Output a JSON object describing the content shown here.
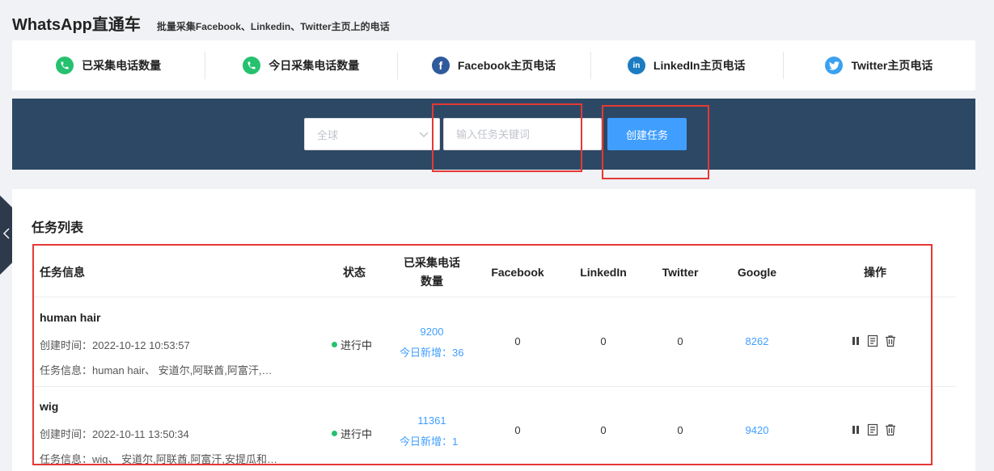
{
  "header": {
    "title": "WhatsApp直通车",
    "subtitle": "批量采集Facebook、Linkedin、Twitter主页上的电话"
  },
  "stats": [
    {
      "label": "已采集电话数量",
      "icon": "phone-icon"
    },
    {
      "label": "今日采集电话数量",
      "icon": "phone-icon"
    },
    {
      "label": "Facebook主页电话",
      "icon": "facebook-icon"
    },
    {
      "label": "LinkedIn主页电话",
      "icon": "linkedin-icon"
    },
    {
      "label": "Twitter主页电话",
      "icon": "twitter-icon"
    }
  ],
  "toolbar": {
    "region_value": "全球",
    "keyword_placeholder": "输入任务关键词",
    "create_label": "创建任务"
  },
  "tasks": {
    "title": "任务列表",
    "headers": {
      "info": "任务信息",
      "status": "状态",
      "collected_1": "已采集电话",
      "collected_2": "数量",
      "facebook": "Facebook",
      "linkedin": "LinkedIn",
      "twitter": "Twitter",
      "google": "Google",
      "ops": "操作"
    },
    "rows": [
      {
        "name": "human hair",
        "created": "创建时间：2022-10-12 10:53:57",
        "info": "任务信息：human hair、 安道尔,阿联酋,阿富汗,安提瓜和巴布达",
        "status": "进行中",
        "collected": "9200",
        "today": "今日新增：36",
        "facebook": "0",
        "linkedin": "0",
        "twitter": "0",
        "google": "8262"
      },
      {
        "name": "wig",
        "created": "创建时间：2022-10-11 13:50:34",
        "info": "任务信息：wig、 安道尔,阿联酋,阿富汗,安提瓜和巴布达",
        "status": "进行中",
        "collected": "11361",
        "today": "今日新增：1",
        "facebook": "0",
        "linkedin": "0",
        "twitter": "0",
        "google": "9420"
      }
    ]
  },
  "colors": {
    "accent": "#409eff",
    "band": "#2d4865",
    "highlight": "#e53935",
    "status_green": "#25c16f"
  }
}
